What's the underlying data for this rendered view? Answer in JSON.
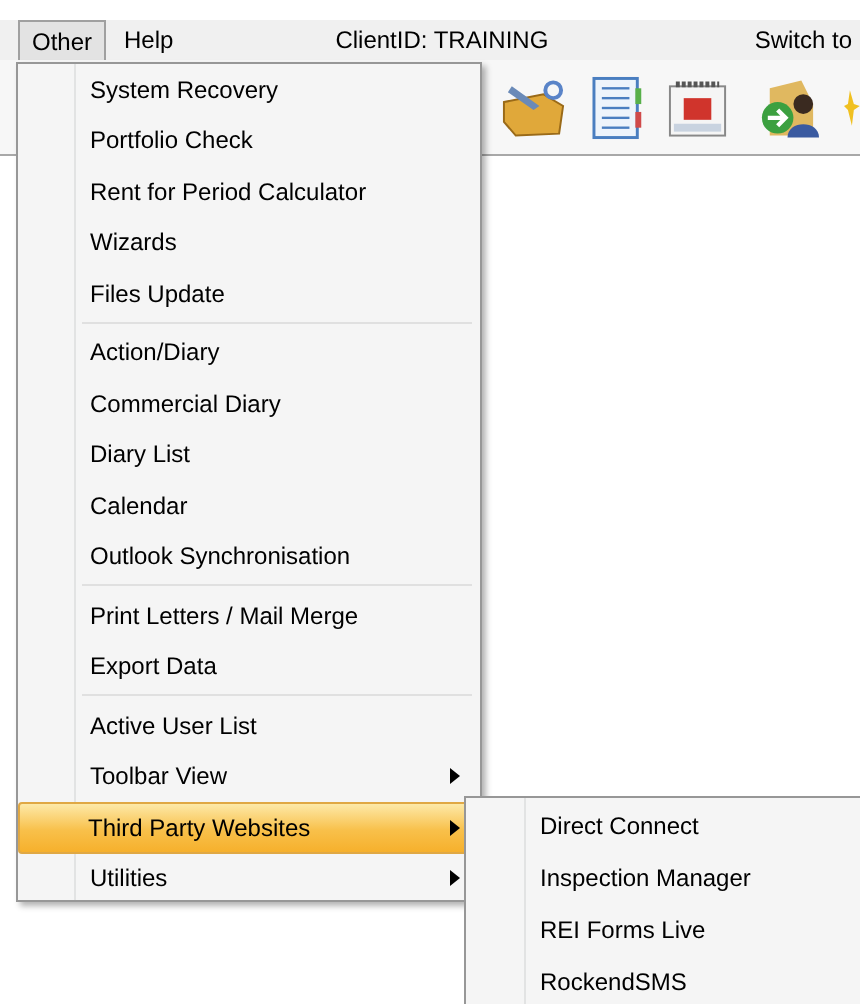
{
  "menubar": [
    {
      "label": "Other",
      "selected": true
    },
    {
      "label": "Help",
      "selected": false
    }
  ],
  "client_id": "ClientID: TRAINING",
  "switch_text": "Switch to",
  "menu": [
    {
      "kind": "item",
      "label": "System Recovery",
      "submenu": false,
      "selected": false
    },
    {
      "kind": "item",
      "label": "Portfolio Check",
      "submenu": false,
      "selected": false
    },
    {
      "kind": "item",
      "label": "Rent for Period Calculator",
      "submenu": false,
      "selected": false
    },
    {
      "kind": "item",
      "label": "Wizards",
      "submenu": false,
      "selected": false
    },
    {
      "kind": "item",
      "label": "Files Update",
      "submenu": false,
      "selected": false
    },
    {
      "kind": "separator"
    },
    {
      "kind": "item",
      "label": "Action/Diary",
      "submenu": false,
      "selected": false
    },
    {
      "kind": "item",
      "label": "Commercial Diary",
      "submenu": false,
      "selected": false
    },
    {
      "kind": "item",
      "label": "Diary List",
      "submenu": false,
      "selected": false
    },
    {
      "kind": "item",
      "label": "Calendar",
      "submenu": false,
      "selected": false
    },
    {
      "kind": "item",
      "label": "Outlook Synchronisation",
      "submenu": false,
      "selected": false
    },
    {
      "kind": "separator"
    },
    {
      "kind": "item",
      "label": "Print Letters / Mail Merge",
      "submenu": false,
      "selected": false
    },
    {
      "kind": "item",
      "label": "Export Data",
      "submenu": false,
      "selected": false
    },
    {
      "kind": "separator"
    },
    {
      "kind": "item",
      "label": "Active User List",
      "submenu": false,
      "selected": false
    },
    {
      "kind": "item",
      "label": "Toolbar View",
      "submenu": true,
      "selected": false
    },
    {
      "kind": "item",
      "label": "Third Party Websites",
      "submenu": true,
      "selected": true
    },
    {
      "kind": "item",
      "label": "Utilities",
      "submenu": true,
      "selected": false
    }
  ],
  "submenu": [
    {
      "label": "Direct Connect",
      "selected": false
    },
    {
      "label": "Inspection Manager",
      "selected": false
    },
    {
      "label": "REI Forms Live",
      "selected": false
    },
    {
      "label": "RockendSMS",
      "selected": false
    }
  ]
}
